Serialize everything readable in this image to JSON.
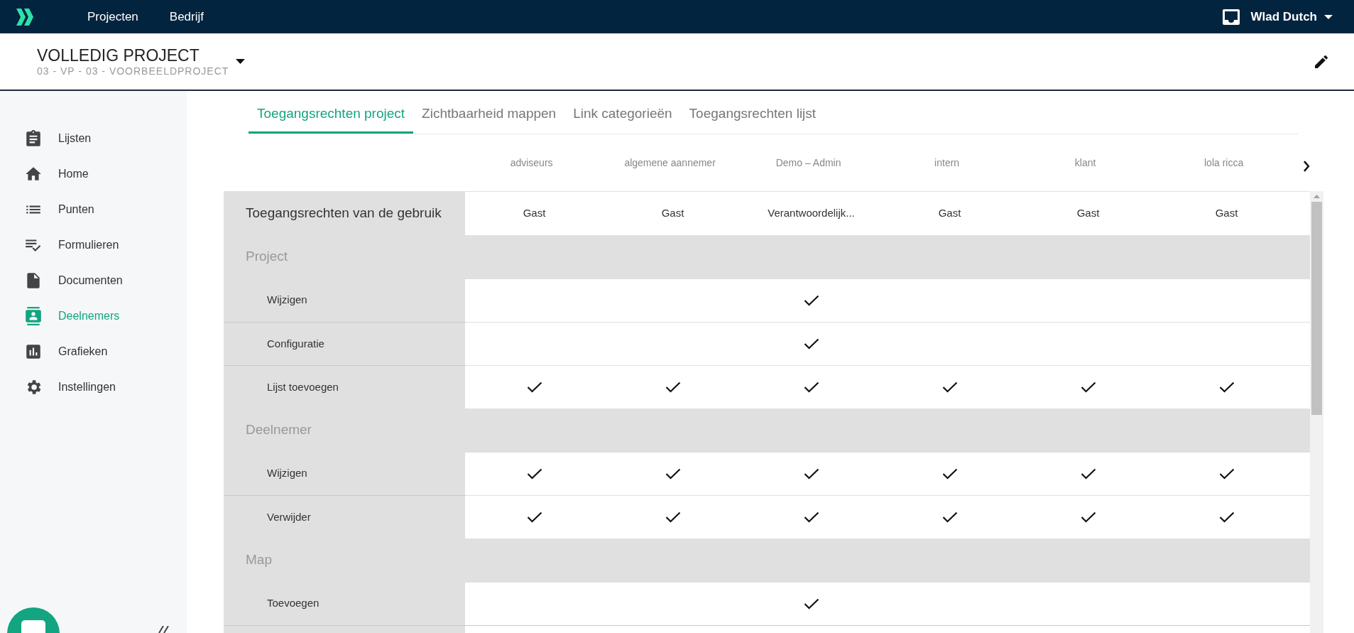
{
  "topbar": {
    "nav": [
      {
        "label": "Projecten"
      },
      {
        "label": "Bedrijf"
      }
    ],
    "user": "Wlad Dutch"
  },
  "project": {
    "title": "VOLLEDIG PROJECT",
    "subtitle": "03 - VP - 03 - VOORBEELDPROJECT"
  },
  "sidebar": {
    "items": [
      {
        "label": "Lijsten",
        "selected": false
      },
      {
        "label": "Home",
        "selected": false
      },
      {
        "label": "Punten",
        "selected": false
      },
      {
        "label": "Formulieren",
        "selected": false
      },
      {
        "label": "Documenten",
        "selected": false
      },
      {
        "label": "Deelnemers",
        "selected": true
      },
      {
        "label": "Grafieken",
        "selected": false
      },
      {
        "label": "Instellingen",
        "selected": false
      }
    ]
  },
  "tabs": [
    {
      "label": "Toegangsrechten project",
      "selected": true
    },
    {
      "label": "Zichtbaarheid mappen",
      "selected": false
    },
    {
      "label": "Link categorieën",
      "selected": false
    },
    {
      "label": "Toegangsrechten lijst",
      "selected": false
    }
  ],
  "table": {
    "columns": [
      "adviseurs",
      "algemene aannemer",
      "Demo – Admin",
      "intern",
      "klant",
      "lola ricca"
    ],
    "rows": [
      {
        "kind": "role",
        "label": "Toegangsrechten van de gebruik",
        "values": [
          "Gast",
          "Gast",
          "Verantwoordelijk...",
          "Gast",
          "Gast",
          "Gast"
        ]
      },
      {
        "kind": "section",
        "label": "Project"
      },
      {
        "kind": "permission",
        "label": "Wijzigen",
        "checks": [
          false,
          false,
          true,
          false,
          false,
          false
        ]
      },
      {
        "kind": "permission",
        "label": "Configuratie",
        "checks": [
          false,
          false,
          true,
          false,
          false,
          false
        ]
      },
      {
        "kind": "permission",
        "label": "Lijst toevoegen",
        "checks": [
          true,
          true,
          true,
          true,
          true,
          true
        ]
      },
      {
        "kind": "section",
        "label": "Deelnemer"
      },
      {
        "kind": "permission",
        "label": "Wijzigen",
        "checks": [
          true,
          true,
          true,
          true,
          true,
          true
        ]
      },
      {
        "kind": "permission",
        "label": "Verwijder",
        "checks": [
          true,
          true,
          true,
          true,
          true,
          true
        ]
      },
      {
        "kind": "section",
        "label": "Map"
      },
      {
        "kind": "permission",
        "label": "Toevoegen",
        "checks": [
          false,
          false,
          true,
          false,
          false,
          false
        ]
      }
    ]
  }
}
